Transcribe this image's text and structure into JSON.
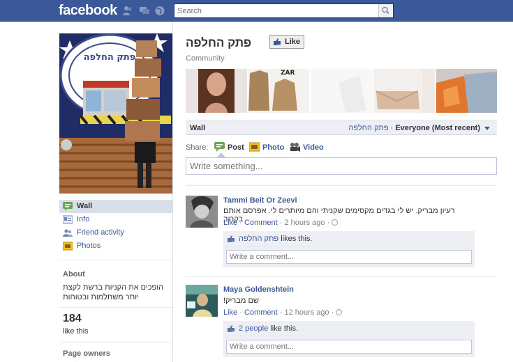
{
  "topbar": {
    "logo": "facebook",
    "search_placeholder": "Search"
  },
  "page": {
    "title": "פתק החלפה",
    "like_button": "Like",
    "category": "Community"
  },
  "sidebar": {
    "items": [
      {
        "label": "Wall",
        "icon": "wall-icon",
        "active": true
      },
      {
        "label": "Info",
        "icon": "info-icon"
      },
      {
        "label": "Friend activity",
        "icon": "friend-activity-icon"
      },
      {
        "label": "Photos",
        "icon": "photos-icon"
      }
    ],
    "about_heading": "About",
    "about_text": "הופכים את הקניות ברשת לקצת יותר משתלמות ובטוחות",
    "likes_count": "184",
    "likes_label": "like this",
    "owners_heading": "Page owners"
  },
  "wall": {
    "title": "Wall",
    "filter_page": "פתק החלפה",
    "filter_sep": " · ",
    "filter_value": "Everyone (Most recent)"
  },
  "share": {
    "label": "Share:",
    "options": [
      "Post",
      "Photo",
      "Video"
    ],
    "placeholder": "Write something..."
  },
  "stories": [
    {
      "author": "Tammi Beit Or Zeevi",
      "message": "רעיון מבריק. יש לי בגדים מקסימים שקניתי והם מיותרים לי. אפרסם אותם בקרוב",
      "like_action": "Like",
      "comment_action": "Comment",
      "time": "2 hours ago",
      "likes_subject": "פתק החלפה",
      "likes_suffix": "likes this.",
      "comment_placeholder": "Write a comment..."
    },
    {
      "author": "Maya Goldenshtein",
      "message": "שם מבריק!",
      "like_action": "Like",
      "comment_action": "Comment",
      "time": "12 hours ago",
      "likes_subject": "2 people",
      "likes_suffix": "like this.",
      "comment_placeholder": "Write a comment..."
    }
  ],
  "strip_photo_text": "ZAR",
  "colors": {
    "brand_blue": "#3b5998",
    "topbar_border": "#133783",
    "panel_bg": "#edeff4"
  }
}
